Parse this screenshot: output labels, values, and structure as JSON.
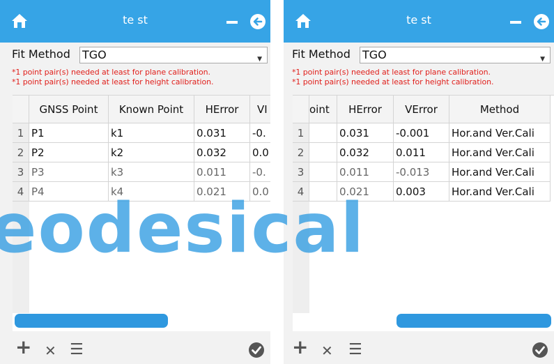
{
  "colors": {
    "titlebar": "#36a4e6",
    "warning": "#e0201c",
    "scrollbar": "#2f98df",
    "watermark": "#3aa0e3"
  },
  "left": {
    "title": "te st",
    "fit_label": "Fit Method",
    "fit_value": "TGO",
    "warning1": "*1 point pair(s) needed at least for plane calibration.",
    "warning2": "*1 point pair(s) needed at least for height calibration.",
    "headers": [
      "GNSS Point",
      "Known Point",
      "HError",
      "VI"
    ],
    "rows": [
      {
        "num": "1",
        "gnss": "P1",
        "known": "k1",
        "herr": "0.031",
        "verr": "-0."
      },
      {
        "num": "2",
        "gnss": "P2",
        "known": "k2",
        "herr": "0.032",
        "verr": "0.0"
      },
      {
        "num": "3",
        "gnss": "P3",
        "known": "k3",
        "herr": "0.011",
        "verr": "-0."
      },
      {
        "num": "4",
        "gnss": "P4",
        "known": "k4",
        "herr": "0.021",
        "verr": "0.0"
      }
    ]
  },
  "right": {
    "title": "te st",
    "fit_label": "Fit Method",
    "fit_value": "TGO",
    "warning1": "*1 point pair(s) needed at least for plane calibration.",
    "warning2": "*1 point pair(s) needed at least for height calibration.",
    "headers": [
      "oint",
      "HError",
      "VError",
      "Method"
    ],
    "rows": [
      {
        "num": "1",
        "herr": "0.031",
        "verr": "-0.001",
        "method": "Hor.and Ver.Cali"
      },
      {
        "num": "2",
        "herr": "0.032",
        "verr": "0.011",
        "method": "Hor.and Ver.Cali"
      },
      {
        "num": "3",
        "herr": "0.011",
        "verr": "-0.013",
        "method": "Hor.and Ver.Cali"
      },
      {
        "num": "4",
        "herr": "0.021",
        "verr": "0.003",
        "method": "Hor.and Ver.Cali"
      }
    ]
  },
  "icons": {
    "home": "home-icon",
    "minimize": "minus-icon",
    "back": "back-arrow-icon",
    "add": "plus-icon",
    "delete": "close-icon",
    "list": "list-icon",
    "confirm": "check-circle-icon"
  },
  "toolbar": {
    "add": "+",
    "delete": "✕",
    "list": "☰"
  },
  "watermark": "eodesical"
}
